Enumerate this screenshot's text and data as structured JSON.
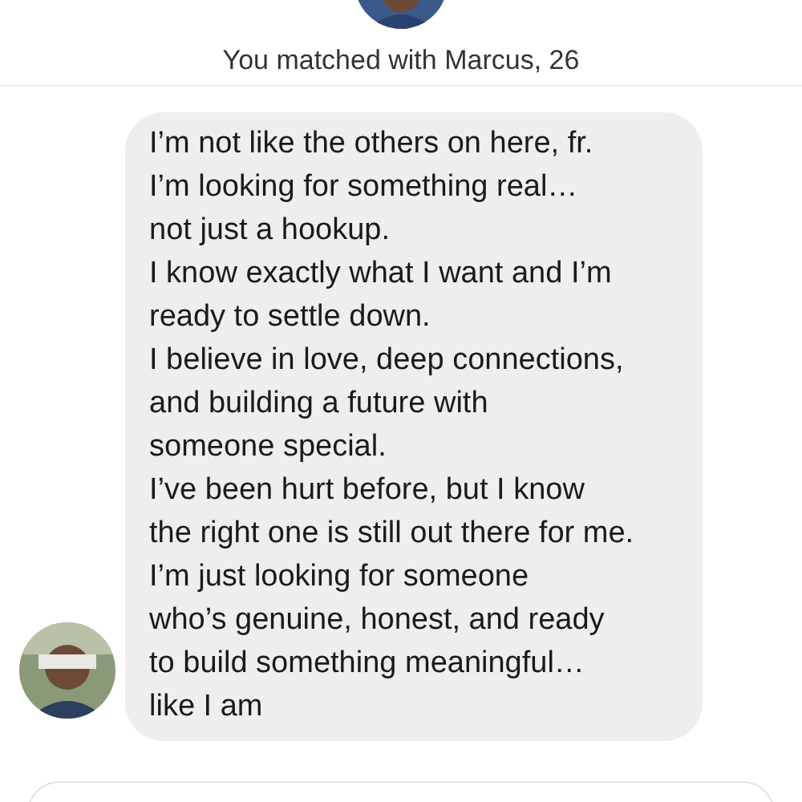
{
  "match_banner": {
    "text": "You matched with Marcus, 26"
  },
  "messages": [
    {
      "kind": "received",
      "text": "I’m not like the others on here, fr.\nI’m looking for something real…\nnot just a hookup.\nI know exactly what I want and I’m\nready to settle down.\nI believe in love, deep connections,\nand building a future with\nsomeone special.\nI’ve been hurt before, but I know\nthe right one is still out there for me.\nI’m just looking for someone\nwho’s genuine, honest, and ready\nto build something meaningful…\nlike I am"
    }
  ]
}
